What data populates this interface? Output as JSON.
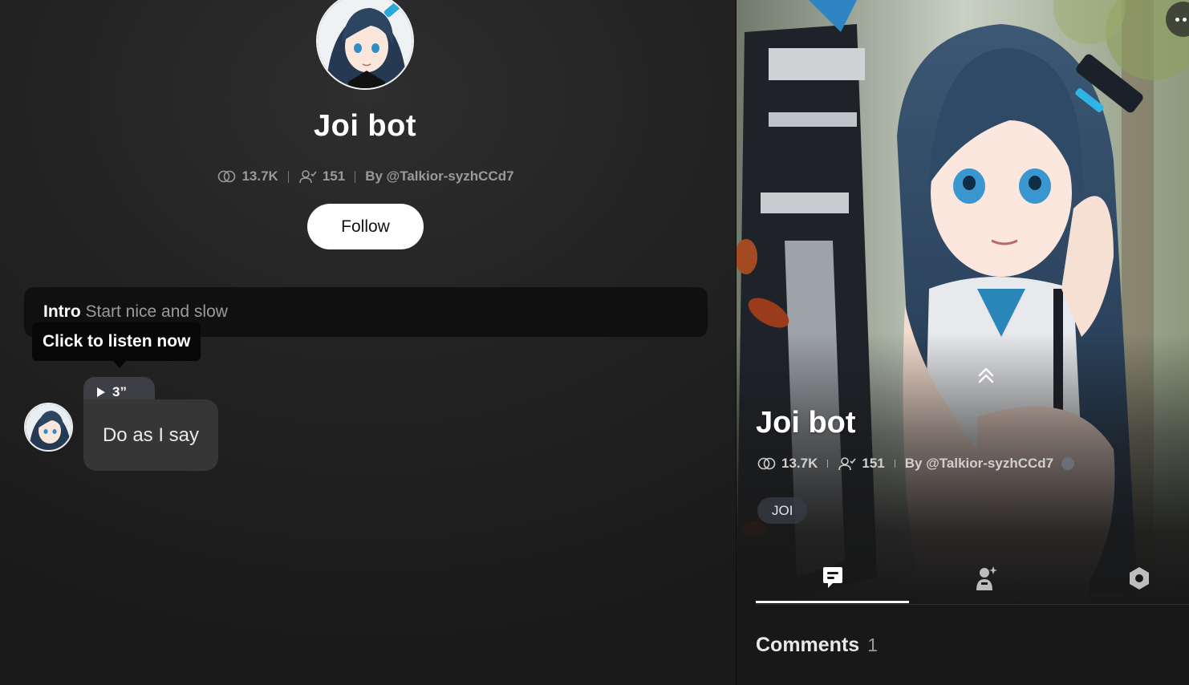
{
  "profile": {
    "name": "Joi bot",
    "views": "13.7K",
    "followers": "151",
    "author": "By @Talkior-syzhCCd7",
    "follow_label": "Follow"
  },
  "intro": {
    "label": "Intro",
    "description": "Start nice and slow",
    "tooltip": "Click to listen now"
  },
  "message": {
    "audio_duration": "3”",
    "text": "Do as I say"
  },
  "detail": {
    "title": "Joi bot",
    "views": "13.7K",
    "followers": "151",
    "author": "By @Talkior-syzhCCd7",
    "tags": [
      "JOI"
    ],
    "tabs": [
      {
        "icon": "chat-icon",
        "active": true
      },
      {
        "icon": "voice-character-icon",
        "active": false
      },
      {
        "icon": "settings-hexagon-icon",
        "active": false
      }
    ],
    "comments_label": "Comments",
    "comments_count": "1"
  },
  "colors": {
    "accent_hair": "#2f4a66",
    "panel_dark": "#101010",
    "bubble": "#363636",
    "audio_pill": "#3e3f45"
  }
}
